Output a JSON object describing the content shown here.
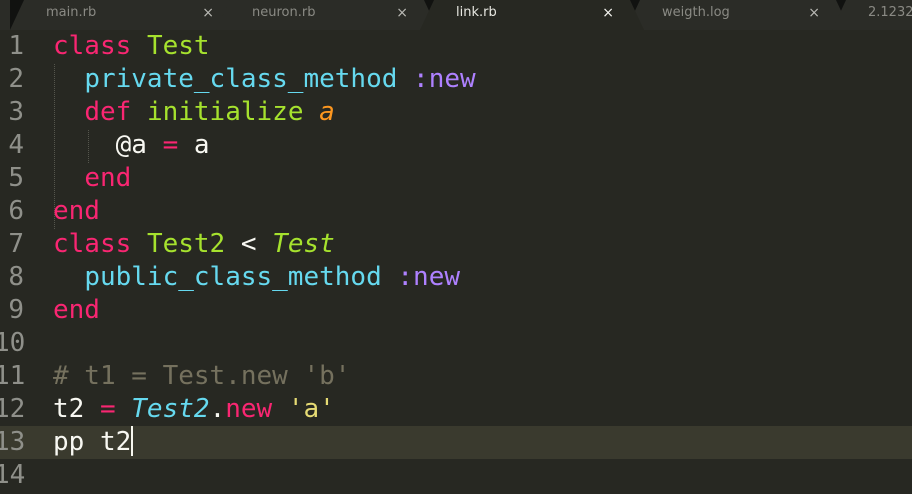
{
  "tabs": [
    {
      "label": "main.rb",
      "close": "×",
      "active": false
    },
    {
      "label": "neuron.rb",
      "close": "×",
      "active": false
    },
    {
      "label": "link.rb",
      "close": "×",
      "active": true
    },
    {
      "label": "weigth.log",
      "close": "×",
      "active": false
    },
    {
      "label": "2.1232",
      "close": "",
      "active": false
    }
  ],
  "editor": {
    "line_numbers": [
      "1",
      "2",
      "3",
      "4",
      "5",
      "6",
      "7",
      "8",
      "9",
      "10",
      "11",
      "12",
      "13",
      "14"
    ],
    "current_line": 13,
    "lines": [
      [
        {
          "t": "class",
          "c": "kw"
        },
        {
          "t": " ",
          "c": "txt"
        },
        {
          "t": "Test",
          "c": "cls"
        }
      ],
      [
        {
          "t": "  ",
          "c": "txt"
        },
        {
          "t": "private_class_method",
          "c": "fn"
        },
        {
          "t": " ",
          "c": "txt"
        },
        {
          "t": ":new",
          "c": "sym"
        }
      ],
      [
        {
          "t": "  ",
          "c": "txt"
        },
        {
          "t": "def",
          "c": "kw"
        },
        {
          "t": " ",
          "c": "txt"
        },
        {
          "t": "initialize",
          "c": "cls"
        },
        {
          "t": " ",
          "c": "txt"
        },
        {
          "t": "a",
          "c": "arg"
        }
      ],
      [
        {
          "t": "    ",
          "c": "txt"
        },
        {
          "t": "@a",
          "c": "txt"
        },
        {
          "t": " ",
          "c": "txt"
        },
        {
          "t": "=",
          "c": "op"
        },
        {
          "t": " a",
          "c": "txt"
        }
      ],
      [
        {
          "t": "  ",
          "c": "txt"
        },
        {
          "t": "end",
          "c": "kw"
        }
      ],
      [
        {
          "t": "end",
          "c": "kw"
        }
      ],
      [
        {
          "t": "class",
          "c": "kw"
        },
        {
          "t": " ",
          "c": "txt"
        },
        {
          "t": "Test2",
          "c": "cls"
        },
        {
          "t": " < ",
          "c": "txt"
        },
        {
          "t": "Test",
          "c": "cls-i"
        }
      ],
      [
        {
          "t": "  ",
          "c": "txt"
        },
        {
          "t": "public_class_method",
          "c": "fn"
        },
        {
          "t": " ",
          "c": "txt"
        },
        {
          "t": ":new",
          "c": "sym"
        }
      ],
      [
        {
          "t": "end",
          "c": "kw"
        }
      ],
      [],
      [
        {
          "t": "# t1 = Test.new 'b'",
          "c": "cmt"
        }
      ],
      [
        {
          "t": "t2",
          "c": "txt"
        },
        {
          "t": " ",
          "c": "txt"
        },
        {
          "t": "=",
          "c": "op"
        },
        {
          "t": " ",
          "c": "txt"
        },
        {
          "t": "Test2",
          "c": "fn-i"
        },
        {
          "t": ".",
          "c": "txt"
        },
        {
          "t": "new",
          "c": "kw"
        },
        {
          "t": " ",
          "c": "txt"
        },
        {
          "t": "'a'",
          "c": "str"
        }
      ],
      [
        {
          "t": "pp t2",
          "c": "txt"
        }
      ],
      []
    ]
  },
  "colors": {
    "background": "#272822",
    "keyword": "#f92672",
    "class_name": "#a6e22e",
    "function": "#66d9ef",
    "symbol": "#ae81ff",
    "argument": "#fd971f",
    "string": "#e6db74",
    "comment": "#75715e",
    "text": "#f8f8f2"
  },
  "icons": {
    "tab_close": "close-icon",
    "cursor": "text-cursor"
  }
}
